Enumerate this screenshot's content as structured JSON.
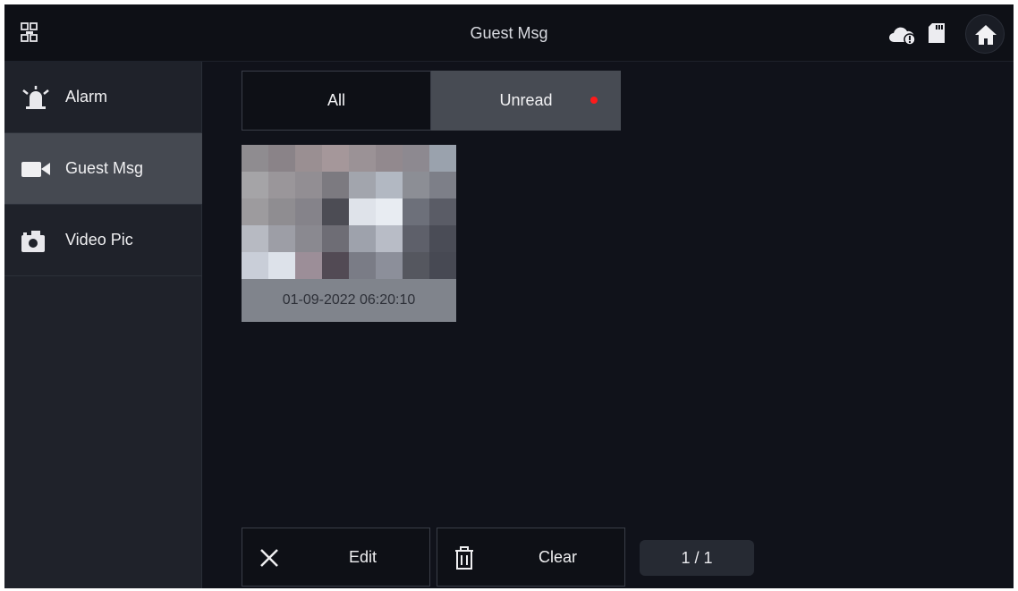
{
  "header": {
    "title": "Guest Msg",
    "icons": [
      "network-icon",
      "cloud-alert-icon",
      "sd-card-icon",
      "home-icon"
    ]
  },
  "sidebar": {
    "items": [
      {
        "label": "Alarm",
        "icon": "alarm-bell-icon",
        "active": false
      },
      {
        "label": "Guest Msg",
        "icon": "video-camera-icon",
        "active": true
      },
      {
        "label": "Video Pic",
        "icon": "camera-icon",
        "active": false
      }
    ]
  },
  "tabs": [
    {
      "label": "All",
      "active": false
    },
    {
      "label": "Unread",
      "active": true,
      "has_new": true
    }
  ],
  "messages": [
    {
      "timestamp": "01-09-2022 06:20:10",
      "thumbnail": "pixelated-snapshot"
    }
  ],
  "toolbar": {
    "edit_label": "Edit",
    "clear_label": "Clear",
    "page_indicator": "1 / 1"
  },
  "colors": {
    "background": "#10121a",
    "sidebar": "#1f222a",
    "active_item": "#454951",
    "unread_dot": "#ff1a1a"
  }
}
